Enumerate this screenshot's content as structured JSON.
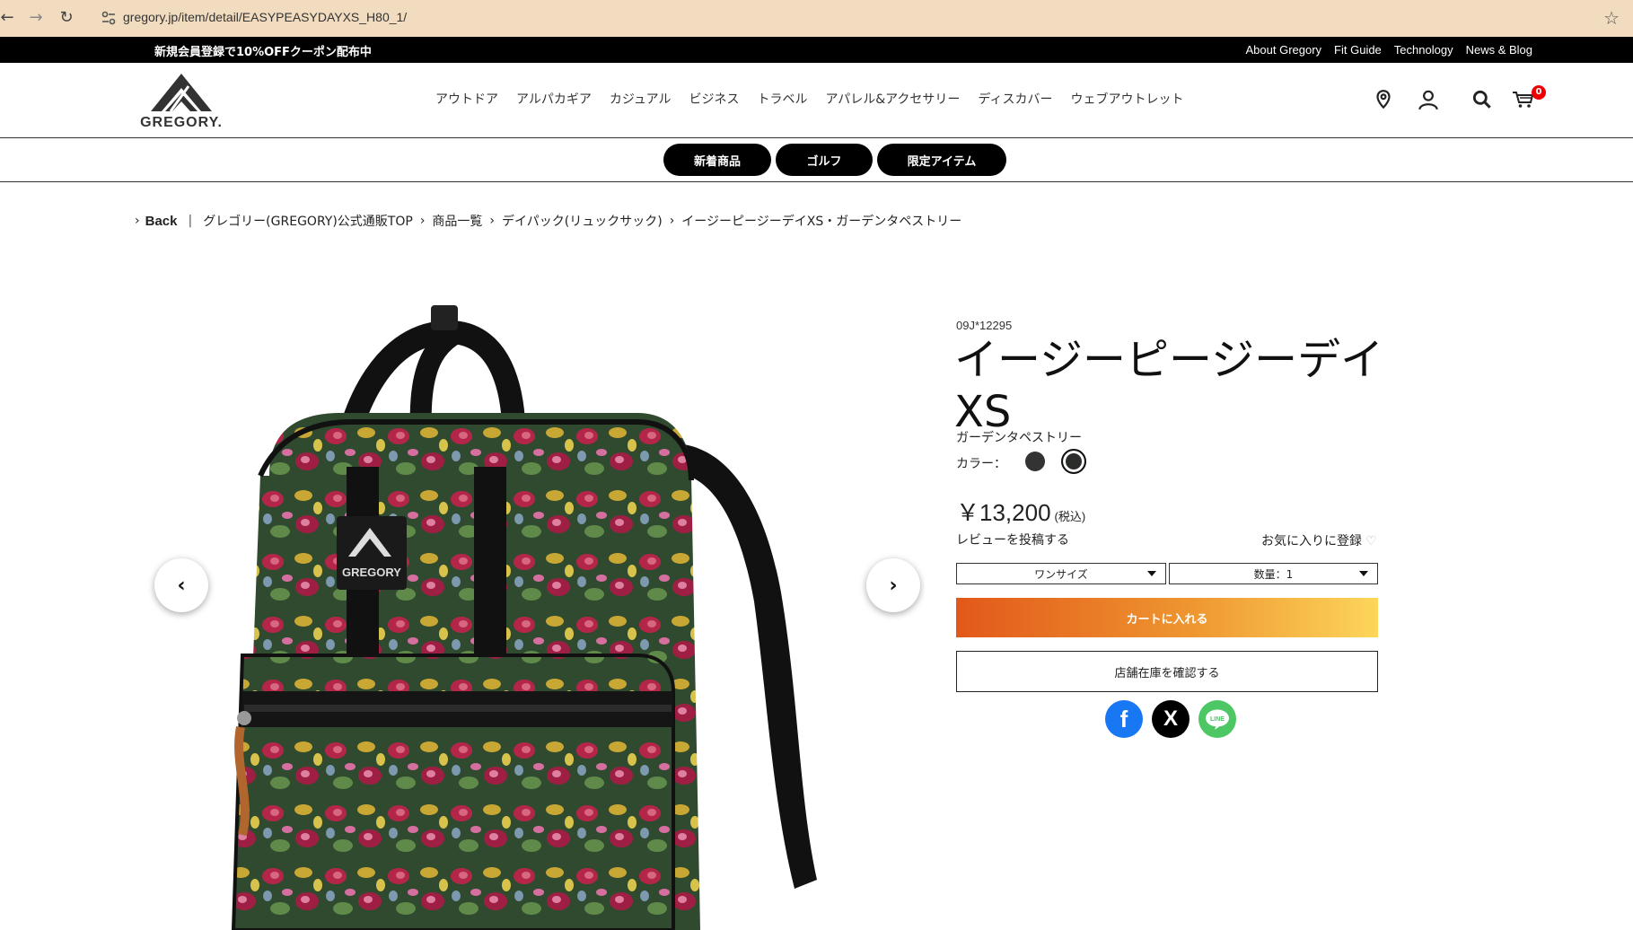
{
  "browser": {
    "url": "gregory.jp/item/detail/EASYPEASYDAYXS_H80_1/"
  },
  "topbar": {
    "promo": "新規会員登録で10%OFFクーポン配布中",
    "links": [
      "About Gregory",
      "Fit Guide",
      "Technology",
      "News & Blog"
    ]
  },
  "header": {
    "logo_text": "GREGORY.",
    "nav": [
      "アウトドア",
      "アルパカギア",
      "カジュアル",
      "ビジネス",
      "トラベル",
      "アパレル&アクセサリー",
      "ディスカバー",
      "ウェブアウトレット"
    ],
    "cart_count": "0"
  },
  "subnav": [
    "新着商品",
    "ゴルフ",
    "限定アイテム"
  ],
  "breadcrumb": {
    "back": "Back",
    "items": [
      "グレゴリー(GREGORY)公式通販TOP",
      "商品一覧",
      "デイパック(リュックサック)",
      "イージーピージーデイXS・ガーデンタペストリー"
    ]
  },
  "product": {
    "sku": "09J*12295",
    "name": "イージーピージーデイXS",
    "color_name": "ガーデンタペストリー",
    "color_label": "カラー：",
    "price": "￥13,200",
    "tax": "(税込)",
    "review": "レビューを投稿する",
    "favorite": "お気に入りに登録",
    "size_select": "ワンサイズ",
    "qty_select": "数量：1",
    "cart_button": "カートに入れる",
    "stock_button": "店舗在庫を確認する"
  },
  "gallery_image": {
    "logo_text": "GREGORY"
  },
  "colors": {
    "accent_start": "#e2581a",
    "accent_end": "#fdd65a",
    "facebook": "#1877f2",
    "x": "#000000",
    "line": "#4cc764"
  }
}
